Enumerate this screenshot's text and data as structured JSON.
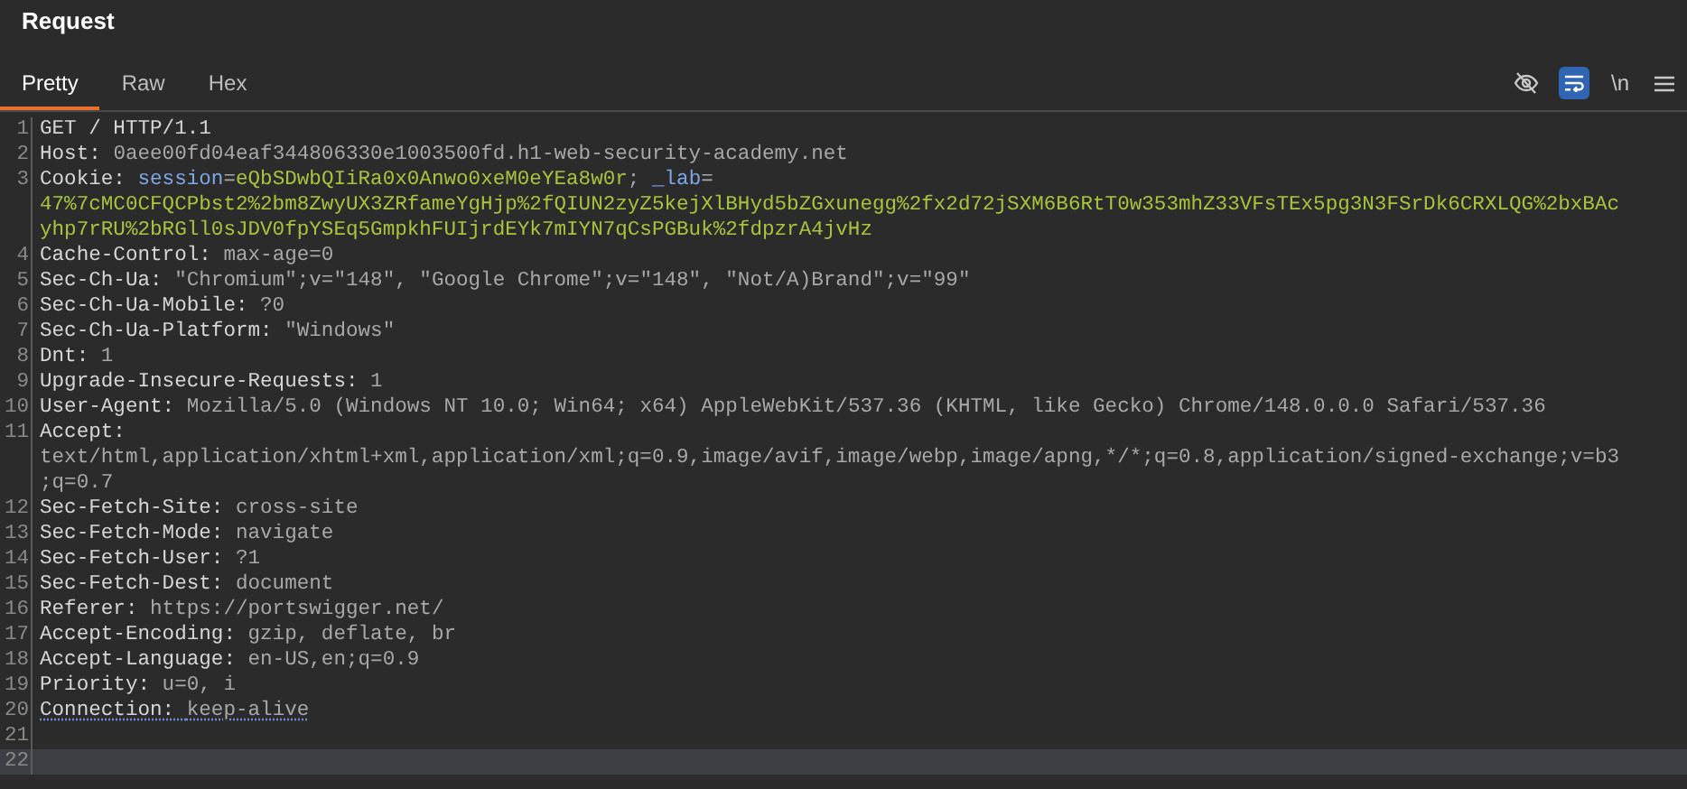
{
  "panel": {
    "title": "Request"
  },
  "tabs": [
    {
      "label": "Pretty",
      "selected": true
    },
    {
      "label": "Raw",
      "selected": false
    },
    {
      "label": "Hex",
      "selected": false
    }
  ],
  "toolbar": [
    {
      "kind": "hide",
      "selected": false
    },
    {
      "kind": "wrap",
      "selected": true
    },
    {
      "kind": "newline",
      "text": "\\n",
      "selected": false
    },
    {
      "kind": "menu",
      "selected": false
    }
  ],
  "editor": {
    "rows": [
      {
        "number": "1",
        "selected": false,
        "underlined": false,
        "segments": [
          {
            "kind": "name",
            "text": "GET / HTTP/1.1"
          }
        ]
      },
      {
        "number": "2",
        "selected": false,
        "underlined": false,
        "segments": [
          {
            "kind": "name",
            "text": "Host: "
          },
          {
            "kind": "value",
            "text": "0aee00fd04eaf344806330e1003500fd.h1-web-security-academy.net"
          }
        ]
      },
      {
        "number": "3",
        "selected": false,
        "underlined": false,
        "segments": [
          {
            "kind": "name",
            "text": "Cookie: "
          },
          {
            "kind": "param",
            "text": "session"
          },
          {
            "kind": "plain",
            "text": "="
          },
          {
            "kind": "cookie",
            "text": "eQbSDwbQIiRa0x0Anwo0xeM0eYEa8w0r"
          },
          {
            "kind": "plain",
            "text": "; "
          },
          {
            "kind": "param",
            "text": "_lab"
          },
          {
            "kind": "plain",
            "text": "="
          }
        ]
      },
      {
        "selected": false,
        "underlined": false,
        "segments": [
          {
            "kind": "cookie",
            "text": "47%7cMC0CFQCPbst2%2bm8ZwyUX3ZRfameYgHjp%2fQIUN2zyZ5kejXlBHyd5bZGxunegg%2fx2d72jSXM6B6RtT0w353mhZ33VFsTEx5pg3N3FSrDk6CRXLQG%2bxBAc"
          }
        ]
      },
      {
        "selected": false,
        "underlined": false,
        "segments": [
          {
            "kind": "cookie",
            "text": "yhp7rRU%2bRGll0sJDV0fpYSEq5GmpkhFUIjrdEYk7mIYN7qCsPGBuk%2fdpzrA4jvHz"
          }
        ]
      },
      {
        "number": "4",
        "selected": false,
        "underlined": false,
        "segments": [
          {
            "kind": "name",
            "text": "Cache-Control: "
          },
          {
            "kind": "value",
            "text": "max-age=0"
          }
        ]
      },
      {
        "number": "5",
        "selected": false,
        "underlined": false,
        "segments": [
          {
            "kind": "name",
            "text": "Sec-Ch-Ua: "
          },
          {
            "kind": "value",
            "text": "\"Chromium\";v=\"148\", \"Google Chrome\";v=\"148\", \"Not/A)Brand\";v=\"99\""
          }
        ]
      },
      {
        "number": "6",
        "selected": false,
        "underlined": false,
        "segments": [
          {
            "kind": "name",
            "text": "Sec-Ch-Ua-Mobile: "
          },
          {
            "kind": "value",
            "text": "?0"
          }
        ]
      },
      {
        "number": "7",
        "selected": false,
        "underlined": false,
        "segments": [
          {
            "kind": "name",
            "text": "Sec-Ch-Ua-Platform: "
          },
          {
            "kind": "value",
            "text": "\"Windows\""
          }
        ]
      },
      {
        "number": "8",
        "selected": false,
        "underlined": false,
        "segments": [
          {
            "kind": "name",
            "text": "Dnt: "
          },
          {
            "kind": "value",
            "text": "1"
          }
        ]
      },
      {
        "number": "9",
        "selected": false,
        "underlined": false,
        "segments": [
          {
            "kind": "name",
            "text": "Upgrade-Insecure-Requests: "
          },
          {
            "kind": "value",
            "text": "1"
          }
        ]
      },
      {
        "number": "10",
        "selected": false,
        "underlined": false,
        "segments": [
          {
            "kind": "name",
            "text": "User-Agent: "
          },
          {
            "kind": "value",
            "text": "Mozilla/5.0 (Windows NT 10.0; Win64; x64) AppleWebKit/537.36 (KHTML, like Gecko) Chrome/148.0.0.0 Safari/537.36"
          }
        ]
      },
      {
        "number": "11",
        "selected": false,
        "underlined": false,
        "segments": [
          {
            "kind": "name",
            "text": "Accept:"
          }
        ]
      },
      {
        "selected": false,
        "underlined": false,
        "segments": [
          {
            "kind": "value",
            "text": "text/html,application/xhtml+xml,application/xml;q=0.9,image/avif,image/webp,image/apng,*/*;q=0.8,application/signed-exchange;v=b3"
          }
        ]
      },
      {
        "selected": false,
        "underlined": false,
        "segments": [
          {
            "kind": "value",
            "text": ";q=0.7"
          }
        ]
      },
      {
        "number": "12",
        "selected": false,
        "underlined": false,
        "segments": [
          {
            "kind": "name",
            "text": "Sec-Fetch-Site: "
          },
          {
            "kind": "value",
            "text": "cross-site"
          }
        ]
      },
      {
        "number": "13",
        "selected": false,
        "underlined": false,
        "segments": [
          {
            "kind": "name",
            "text": "Sec-Fetch-Mode: "
          },
          {
            "kind": "value",
            "text": "navigate"
          }
        ]
      },
      {
        "number": "14",
        "selected": false,
        "underlined": false,
        "segments": [
          {
            "kind": "name",
            "text": "Sec-Fetch-User: "
          },
          {
            "kind": "value",
            "text": "?1"
          }
        ]
      },
      {
        "number": "15",
        "selected": false,
        "underlined": false,
        "segments": [
          {
            "kind": "name",
            "text": "Sec-Fetch-Dest: "
          },
          {
            "kind": "value",
            "text": "document"
          }
        ]
      },
      {
        "number": "16",
        "selected": false,
        "underlined": false,
        "segments": [
          {
            "kind": "name",
            "text": "Referer: "
          },
          {
            "kind": "value",
            "text": "https://portswigger.net/"
          }
        ]
      },
      {
        "number": "17",
        "selected": false,
        "underlined": false,
        "segments": [
          {
            "kind": "name",
            "text": "Accept-Encoding: "
          },
          {
            "kind": "value",
            "text": "gzip, deflate, br"
          }
        ]
      },
      {
        "number": "18",
        "selected": false,
        "underlined": false,
        "segments": [
          {
            "kind": "name",
            "text": "Accept-Language: "
          },
          {
            "kind": "value",
            "text": "en-US,en;q=0.9"
          }
        ]
      },
      {
        "number": "19",
        "selected": false,
        "underlined": false,
        "segments": [
          {
            "kind": "name",
            "text": "Priority: "
          },
          {
            "kind": "value",
            "text": "u=0, i"
          }
        ]
      },
      {
        "number": "20",
        "selected": false,
        "underlined": true,
        "segments": [
          {
            "kind": "name",
            "text": "Connection: "
          },
          {
            "kind": "value",
            "text": "keep-alive"
          }
        ]
      },
      {
        "number": "21",
        "selected": false,
        "segments": []
      },
      {
        "number": "22",
        "selected": true,
        "segments": []
      }
    ]
  }
}
